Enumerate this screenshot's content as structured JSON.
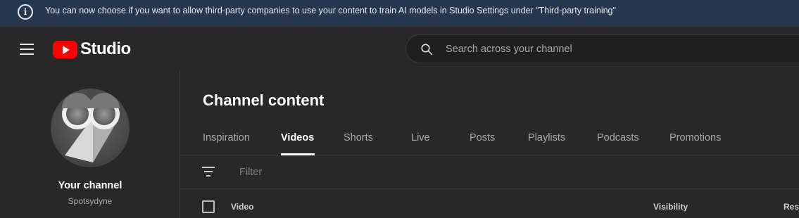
{
  "banner": {
    "text": "You can now choose if you want to allow third-party companies to use your content to train AI models in Studio Settings under \"Third-party training\"",
    "icon": "info-icon"
  },
  "header": {
    "logo_text": "Studio",
    "search_placeholder": "Search across your channel"
  },
  "sidebar": {
    "channel_label": "Your channel",
    "channel_handle": "Spotsydyne"
  },
  "main": {
    "title": "Channel content",
    "tabs": [
      {
        "label": "Inspiration",
        "active": false
      },
      {
        "label": "Videos",
        "active": true
      },
      {
        "label": "Shorts",
        "active": false
      },
      {
        "label": "Live",
        "active": false
      },
      {
        "label": "Posts",
        "active": false
      },
      {
        "label": "Playlists",
        "active": false
      },
      {
        "label": "Podcasts",
        "active": false
      },
      {
        "label": "Promotions",
        "active": false
      }
    ],
    "filter_placeholder": "Filter",
    "columns": [
      "Video",
      "Visibility",
      "Rest"
    ]
  },
  "colors": {
    "banner_bg": "#263850",
    "brand_red": "#ff0000",
    "page_bg": "#282828"
  }
}
